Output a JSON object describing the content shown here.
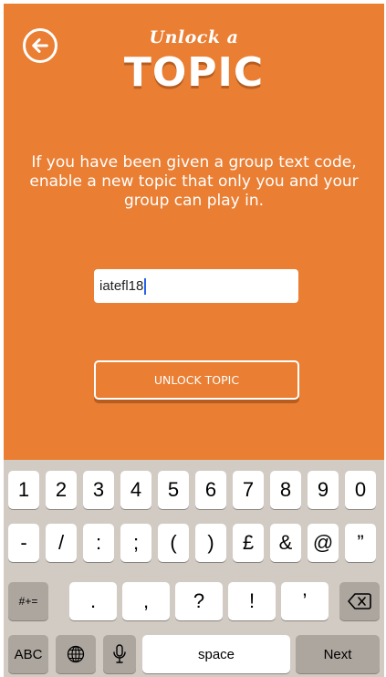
{
  "header": {
    "script_title": "Unlock a",
    "main_title": "TOPIC"
  },
  "intro_text": "If you have been given a group text code, enable a new topic that only you and your group can play in.",
  "code_field": {
    "value": "iatefl18"
  },
  "unlock_button": {
    "label": "UNLOCK TOPIC"
  },
  "keyboard": {
    "row1": [
      "1",
      "2",
      "3",
      "4",
      "5",
      "6",
      "7",
      "8",
      "9",
      "0"
    ],
    "row2": [
      "-",
      "/",
      ":",
      ";",
      "(",
      ")",
      "£",
      "&",
      "@",
      "”"
    ],
    "row3_left": "#+=",
    "row3": [
      ".",
      ",",
      "?",
      "!",
      "’"
    ],
    "abc": "ABC",
    "space": "space",
    "next": "Next"
  },
  "colors": {
    "brand_orange": "#ea7e33",
    "keyboard_bg": "#d2cbc4"
  }
}
